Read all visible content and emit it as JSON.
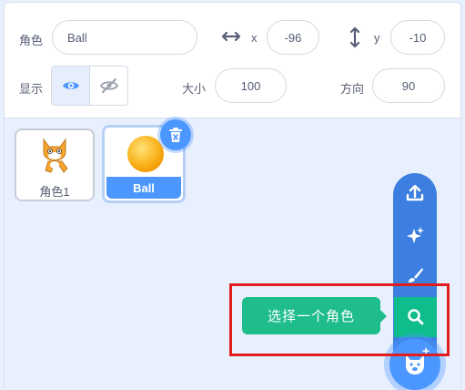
{
  "info": {
    "sprite_label": "角色",
    "sprite_name": "Ball",
    "x_label": "x",
    "x_value": "-96",
    "y_label": "y",
    "y_value": "-10",
    "show_label": "显示",
    "size_label": "大小",
    "size_value": "100",
    "direction_label": "方向",
    "direction_value": "90"
  },
  "sprites": [
    {
      "name": "角色1",
      "selected": false
    },
    {
      "name": "Ball",
      "selected": true
    }
  ],
  "add_menu": {
    "tooltip": "选择一个角色"
  },
  "colors": {
    "accent": "#4c97ff",
    "menu": "#3d7fe0",
    "tooltip": "#1fbd8c",
    "highlight": "#e21d1d"
  }
}
